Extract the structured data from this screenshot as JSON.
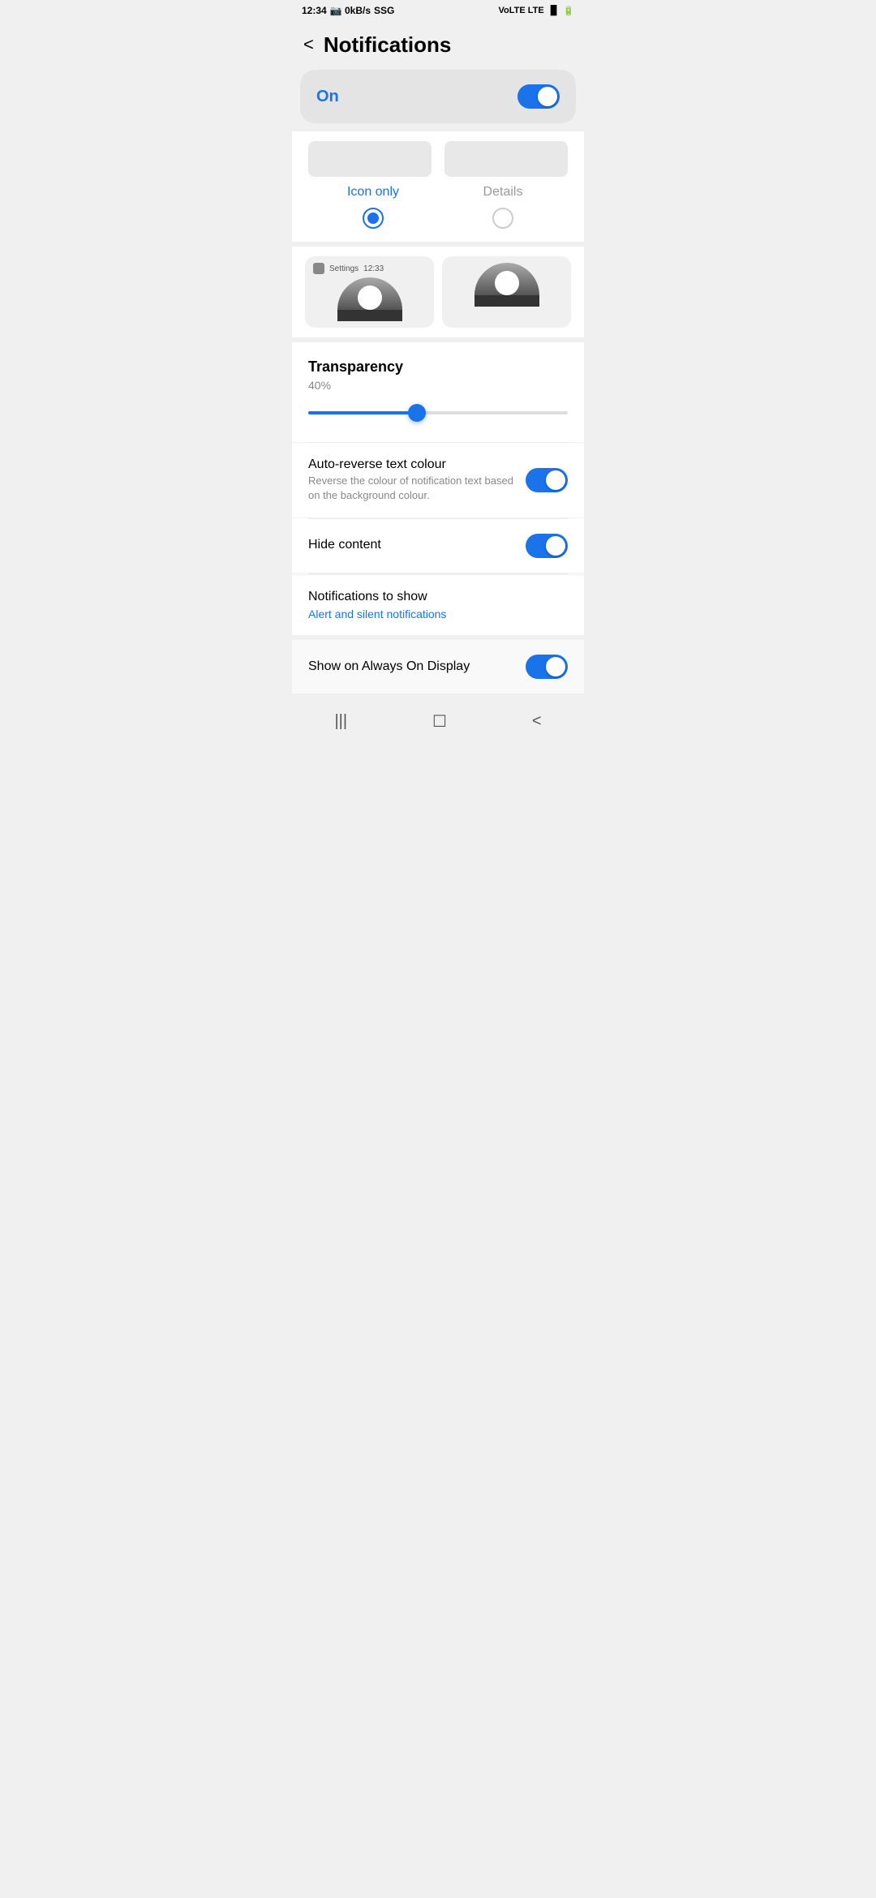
{
  "statusBar": {
    "time": "12:34",
    "carrier": "SSG",
    "signal": "VoLTE LTE"
  },
  "header": {
    "backLabel": "<",
    "title": "Notifications"
  },
  "mainToggle": {
    "label": "On",
    "state": true
  },
  "displayMode": {
    "iconOnly": {
      "label": "Icon only",
      "selected": true
    },
    "details": {
      "label": "Details",
      "selected": false
    }
  },
  "transparency": {
    "title": "Transparency",
    "percent": "40%",
    "value": 40
  },
  "autoReverse": {
    "title": "Auto-reverse text colour",
    "subtitle": "Reverse the colour of notification text based on the background colour.",
    "state": true
  },
  "hideContent": {
    "title": "Hide content",
    "state": true
  },
  "notificationsToShow": {
    "title": "Notifications to show",
    "subtitle": "Alert and silent notifications"
  },
  "showOnAOD": {
    "title": "Show on Always On Display",
    "state": true
  },
  "bottomNav": {
    "recent": "|||",
    "home": "☐",
    "back": "<"
  }
}
